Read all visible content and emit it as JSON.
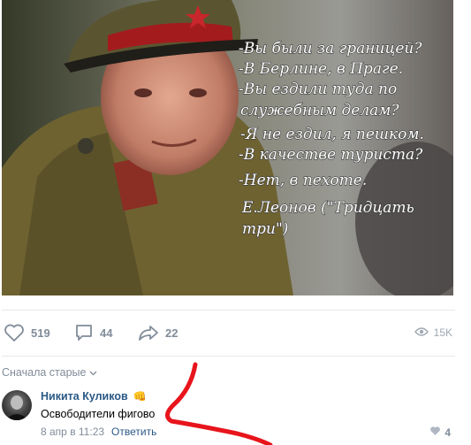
{
  "post": {
    "quote_lines": [
      "-Вы были за границей?",
      "-В Берлине, в Праге.",
      "-Вы ездили туда по",
      "служебным делам?",
      "-Я не ездил, я пешком.",
      "-В качестве туриста?",
      "-Нет, в пехоте.",
      "Е.Леонов (\"Тридцать",
      "три\")"
    ],
    "likes": "519",
    "comments": "44",
    "shares": "22",
    "views": "15K",
    "icons": [
      "heart-icon",
      "comment-icon",
      "share-icon",
      "eye-icon"
    ]
  },
  "comments_section": {
    "sort_label": "Сначала старые",
    "items": [
      {
        "author": "Никита Куликов",
        "author_emoji": "👊",
        "text": "Освободители фигово",
        "date": "8 апр в 11:23",
        "reply_label": "Ответить",
        "likes": "4"
      }
    ]
  },
  "colors": {
    "link": "#2a5885",
    "muted": "#818c99",
    "annotation": "#e8141c"
  }
}
